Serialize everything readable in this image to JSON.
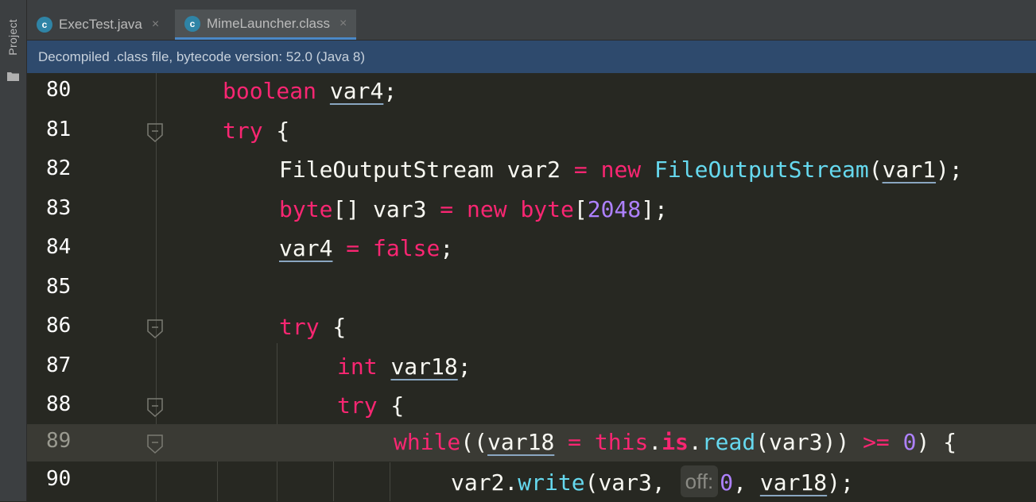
{
  "sidebar": {
    "project_label": "Project"
  },
  "tabs": [
    {
      "label": "ExecTest.java",
      "active": false,
      "icon": "java-class-icon"
    },
    {
      "label": "MimeLauncher.class",
      "active": true,
      "icon": "class-file-icon"
    }
  ],
  "tab_close_glyph": "×",
  "infobar": {
    "text": "Decompiled .class file, bytecode version: 52.0 (Java 8)"
  },
  "editor": {
    "current_line": "89",
    "lines": [
      {
        "num": "80",
        "parts": [
          "boolean",
          " ",
          "var4",
          ";"
        ]
      },
      {
        "num": "81",
        "parts": [
          "try",
          " {"
        ]
      },
      {
        "num": "82",
        "parts": [
          "FileOutputStream var2 ",
          "=",
          " ",
          "new",
          " ",
          "FileOutputStream",
          "(",
          "var1",
          ");"
        ]
      },
      {
        "num": "83",
        "parts": [
          "byte",
          "[] var3 ",
          "=",
          " ",
          "new",
          " ",
          "byte",
          "[",
          "2048",
          "];"
        ]
      },
      {
        "num": "84",
        "parts": [
          "var4",
          " ",
          "=",
          " ",
          "false",
          ";"
        ]
      },
      {
        "num": "85",
        "parts": []
      },
      {
        "num": "86",
        "parts": [
          "try",
          " {"
        ]
      },
      {
        "num": "87",
        "parts": [
          "int",
          " ",
          "var18",
          ";"
        ]
      },
      {
        "num": "88",
        "parts": [
          "try",
          " {"
        ]
      },
      {
        "num": "89",
        "parts": [
          "while",
          "((",
          "var18",
          " ",
          "=",
          " ",
          "this",
          ".",
          "is",
          ".",
          "read",
          "(var3)) ",
          ">=",
          " ",
          "0",
          ") {"
        ]
      },
      {
        "num": "90",
        "parts": [
          "var2.",
          "write",
          "(var3, ",
          "off:",
          "0",
          ", ",
          "var18",
          ");"
        ]
      }
    ]
  },
  "colors": {
    "keyword": "#f92672",
    "type": "#66d9ef",
    "number": "#ae81ff",
    "infobar_bg": "#2e4a6d",
    "editor_bg": "#272822"
  }
}
